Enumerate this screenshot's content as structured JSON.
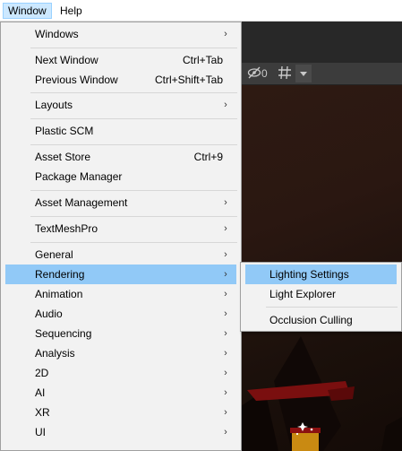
{
  "menubar": {
    "items": [
      {
        "label": "Window"
      },
      {
        "label": "Help"
      }
    ]
  },
  "scene_toolbar": {
    "hidden_count": "0"
  },
  "window_menu": {
    "items": [
      {
        "label": "Windows",
        "shortcut": "",
        "submenu": true
      },
      {
        "label": "Next Window",
        "shortcut": "Ctrl+Tab",
        "submenu": false
      },
      {
        "label": "Previous Window",
        "shortcut": "Ctrl+Shift+Tab",
        "submenu": false
      },
      {
        "label": "Layouts",
        "shortcut": "",
        "submenu": true
      },
      {
        "label": "Plastic SCM",
        "shortcut": "",
        "submenu": false
      },
      {
        "label": "Asset Store",
        "shortcut": "Ctrl+9",
        "submenu": false
      },
      {
        "label": "Package Manager",
        "shortcut": "",
        "submenu": false
      },
      {
        "label": "Asset Management",
        "shortcut": "",
        "submenu": true
      },
      {
        "label": "TextMeshPro",
        "shortcut": "",
        "submenu": true
      },
      {
        "label": "General",
        "shortcut": "",
        "submenu": true
      },
      {
        "label": "Rendering",
        "shortcut": "",
        "submenu": true,
        "highlighted": true
      },
      {
        "label": "Animation",
        "shortcut": "",
        "submenu": true
      },
      {
        "label": "Audio",
        "shortcut": "",
        "submenu": true
      },
      {
        "label": "Sequencing",
        "shortcut": "",
        "submenu": true
      },
      {
        "label": "Analysis",
        "shortcut": "",
        "submenu": true
      },
      {
        "label": "2D",
        "shortcut": "",
        "submenu": true
      },
      {
        "label": "AI",
        "shortcut": "",
        "submenu": true
      },
      {
        "label": "XR",
        "shortcut": "",
        "submenu": true
      },
      {
        "label": "UI",
        "shortcut": "",
        "submenu": true
      }
    ],
    "submenu_arrow": "›"
  },
  "rendering_submenu": {
    "items": [
      {
        "label": "Lighting Settings",
        "highlighted": true
      },
      {
        "label": "Light Explorer"
      },
      {
        "label": "Occlusion Culling"
      }
    ]
  },
  "colors": {
    "menu_bg": "#f2f2f2",
    "highlight": "#91c9f7",
    "menubar_active": "#cce8ff"
  }
}
